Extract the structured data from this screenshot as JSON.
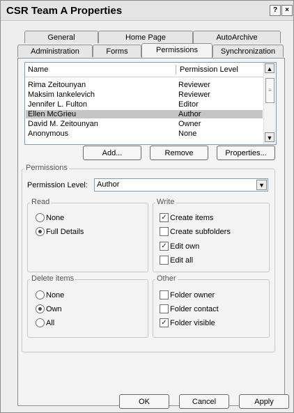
{
  "window": {
    "title": "CSR Team A Properties",
    "help_glyph": "?",
    "close_glyph": "×"
  },
  "tabs": [
    {
      "label": "General"
    },
    {
      "label": "Home Page"
    },
    {
      "label": "AutoArchive"
    },
    {
      "label": "Administration"
    },
    {
      "label": "Forms"
    },
    {
      "label": "Permissions"
    },
    {
      "label": "Synchronization"
    }
  ],
  "list": {
    "columns": {
      "name": "Name",
      "level": "Permission Level"
    },
    "rows": [
      {
        "name": "Rima Zeitounyan",
        "level": "Reviewer"
      },
      {
        "name": "Maksim Iankelevich",
        "level": "Reviewer"
      },
      {
        "name": "Jennifer L. Fulton",
        "level": "Editor"
      },
      {
        "name": "Ellen McGrieu",
        "level": "Author"
      },
      {
        "name": "David M. Zeitounyan",
        "level": "Owner"
      },
      {
        "name": "Anonymous",
        "level": "None"
      }
    ],
    "selected_index": 3,
    "scroll_up": "▲",
    "scroll_down": "▼"
  },
  "list_buttons": {
    "add": "Add...",
    "remove": "Remove",
    "properties": "Properties..."
  },
  "permissions": {
    "group_label": "Permissions",
    "level_label": "Permission Level:",
    "level_value": "Author",
    "dropdown_glyph": "▼",
    "read": {
      "label": "Read",
      "options": [
        "None",
        "Full Details"
      ],
      "selected": "Full Details"
    },
    "write": {
      "label": "Write",
      "options": [
        {
          "label": "Create items",
          "checked": true
        },
        {
          "label": "Create subfolders",
          "checked": false
        },
        {
          "label": "Edit own",
          "checked": true
        },
        {
          "label": "Edit all",
          "checked": false
        }
      ]
    },
    "delete": {
      "label": "Delete items",
      "options": [
        "None",
        "Own",
        "All"
      ],
      "selected": "Own"
    },
    "other": {
      "label": "Other",
      "options": [
        {
          "label": "Folder owner",
          "checked": false
        },
        {
          "label": "Folder contact",
          "checked": false
        },
        {
          "label": "Folder visible",
          "checked": true
        }
      ]
    },
    "check_glyph": "✓"
  },
  "footer": {
    "ok": "OK",
    "cancel": "Cancel",
    "apply": "Apply"
  }
}
